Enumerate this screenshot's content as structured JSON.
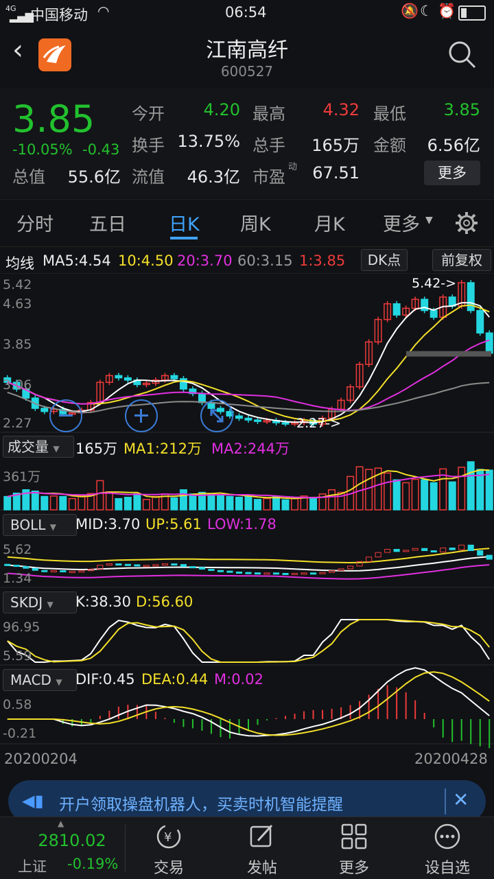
{
  "status": {
    "carrier": "中国移动",
    "network": "4G",
    "time": "06:54"
  },
  "header": {
    "name": "江南高纤",
    "code": "600527"
  },
  "quote": {
    "price": "3.85",
    "change_pct": "-10.05%",
    "change": "-0.43",
    "fields": [
      {
        "label": "今开",
        "value": "4.20",
        "color": "green"
      },
      {
        "label": "最高",
        "value": "4.32",
        "color": "red"
      },
      {
        "label": "最低",
        "value": "3.85",
        "color": "green"
      },
      {
        "label": "换手",
        "value": "13.75%",
        "color": "white"
      },
      {
        "label": "总手",
        "value": "165万",
        "color": "white"
      },
      {
        "label": "金额",
        "value": "6.56亿",
        "color": "white"
      },
      {
        "label": "总值",
        "value": "55.6亿",
        "color": "white"
      },
      {
        "label": "流值",
        "value": "46.3亿",
        "color": "white"
      },
      {
        "label": "市盈",
        "value": "67.51",
        "color": "white"
      }
    ],
    "pe_sup": "动",
    "more_button": "更多"
  },
  "tabs": [
    "分时",
    "五日",
    "日K",
    "周K",
    "月K",
    "更多"
  ],
  "active_tab": "日K",
  "ma_row": {
    "title": "均线",
    "ma5": "MA5:4.54",
    "ma10": "10:4.50",
    "ma20": "20:3.70",
    "ma60": "60:3.15",
    "ma1": "1:3.85",
    "dk_button": "DK点",
    "fq_button": "前复权"
  },
  "kline_axis": {
    "a": "5.42",
    "b": "4.63",
    "c": "3.85",
    "d": "3.06",
    "e": "2.27",
    "high_mark": "5.42->",
    "low_mark": "2.27->"
  },
  "vol_row": {
    "title": "成交量",
    "total": "165万",
    "ma1": "MA1:212万",
    "ma2": "MA2:244万",
    "axis_top": "361万"
  },
  "boll_row": {
    "title": "BOLL",
    "mid": "MID:3.70",
    "up": "UP:5.61",
    "low": "LOW:1.78",
    "axis_top": "5.62",
    "axis_bottom": "1.34"
  },
  "skdj_row": {
    "title": "SKDJ",
    "k": "K:38.30",
    "d": "D:56.60",
    "axis_top": "96.95",
    "axis_bottom": "5.59"
  },
  "macd_row": {
    "title": "MACD",
    "dif": "DIF:0.45",
    "dea": "DEA:0.44",
    "m": "M:0.02",
    "axis_top": "0.58",
    "axis_bottom": "-0.21"
  },
  "dates": {
    "start": "20200204",
    "end": "20200428"
  },
  "chart_data": {
    "type": "candlestick",
    "ma_lines": [
      "MA5",
      "MA10",
      "MA20",
      "MA60"
    ],
    "y_range": [
      2.27,
      5.42
    ],
    "close_samples": [
      3.2,
      3.05,
      2.85,
      2.62,
      2.55,
      2.6,
      2.5,
      2.52,
      2.58,
      2.75,
      3.2,
      3.35,
      3.3,
      3.25,
      3.15,
      3.18,
      3.25,
      3.35,
      3.28,
      3.05,
      2.95,
      2.75,
      2.62,
      2.55,
      2.45,
      2.4,
      2.36,
      2.33,
      2.35,
      2.3,
      2.28,
      2.3,
      2.35,
      2.27,
      2.4,
      2.6,
      2.8,
      3.1,
      3.6,
      4.1,
      4.6,
      4.95,
      4.7,
      4.85,
      5.05,
      4.8,
      4.65,
      5.1,
      4.9,
      5.42,
      4.8,
      4.3,
      3.85
    ]
  },
  "banner": {
    "text": "开户领取操盘机器人，买卖时机智能提醒"
  },
  "bottom": {
    "index_value": "2810.02",
    "index_name": "上证",
    "index_change": "-0.19%",
    "items": [
      "交易",
      "发帖",
      "更多",
      "设自选"
    ]
  }
}
